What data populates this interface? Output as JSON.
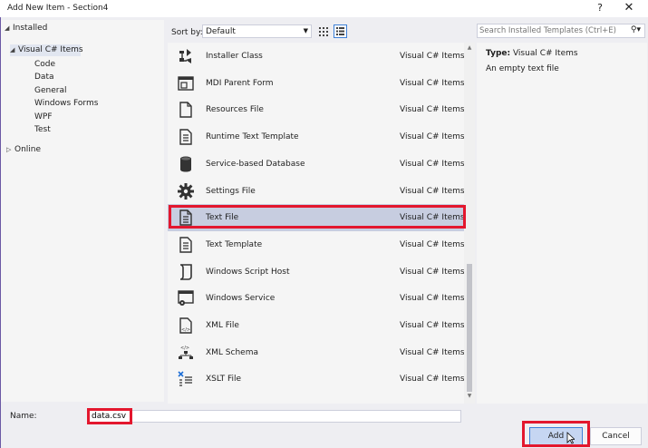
{
  "window": {
    "title": "Add New Item - Section4",
    "help_glyph": "?",
    "close_glyph": "✕"
  },
  "tree": {
    "installed": "Installed",
    "visual_csharp_items": "Visual C# Items",
    "children": [
      "Code",
      "Data",
      "General",
      "Windows Forms",
      "WPF",
      "Test"
    ],
    "online": "Online"
  },
  "toolbar": {
    "sort_label": "Sort by:",
    "sort_value": "Default"
  },
  "search": {
    "placeholder": "Search Installed Templates (Ctrl+E)"
  },
  "templates": [
    {
      "name": "Installer Class",
      "category": "Visual C# Items",
      "icon": "installer-icon"
    },
    {
      "name": "MDI Parent Form",
      "category": "Visual C# Items",
      "icon": "mdi-form-icon"
    },
    {
      "name": "Resources File",
      "category": "Visual C# Items",
      "icon": "resource-file-icon"
    },
    {
      "name": "Runtime Text Template",
      "category": "Visual C# Items",
      "icon": "text-template-icon"
    },
    {
      "name": "Service-based Database",
      "category": "Visual C# Items",
      "icon": "database-icon"
    },
    {
      "name": "Settings File",
      "category": "Visual C# Items",
      "icon": "gear-icon"
    },
    {
      "name": "Text File",
      "category": "Visual C# Items",
      "icon": "text-file-icon",
      "selected": true
    },
    {
      "name": "Text Template",
      "category": "Visual C# Items",
      "icon": "text-template-icon"
    },
    {
      "name": "Windows Script Host",
      "category": "Visual C# Items",
      "icon": "script-icon"
    },
    {
      "name": "Windows Service",
      "category": "Visual C# Items",
      "icon": "service-icon"
    },
    {
      "name": "XML File",
      "category": "Visual C# Items",
      "icon": "xml-file-icon"
    },
    {
      "name": "XML Schema",
      "category": "Visual C# Items",
      "icon": "xml-schema-icon"
    },
    {
      "name": "XSLT File",
      "category": "Visual C# Items",
      "icon": "xslt-file-icon"
    }
  ],
  "details": {
    "type_label": "Type:",
    "type_value": "Visual C# Items",
    "description": "An empty text file"
  },
  "bottom": {
    "name_label": "Name:",
    "name_value": "data.csv",
    "add_label": "Add",
    "cancel_label": "Cancel"
  },
  "colors": {
    "highlight": "#e3172e",
    "selection": "#c7cde0",
    "accent": "#3c7fd7"
  }
}
